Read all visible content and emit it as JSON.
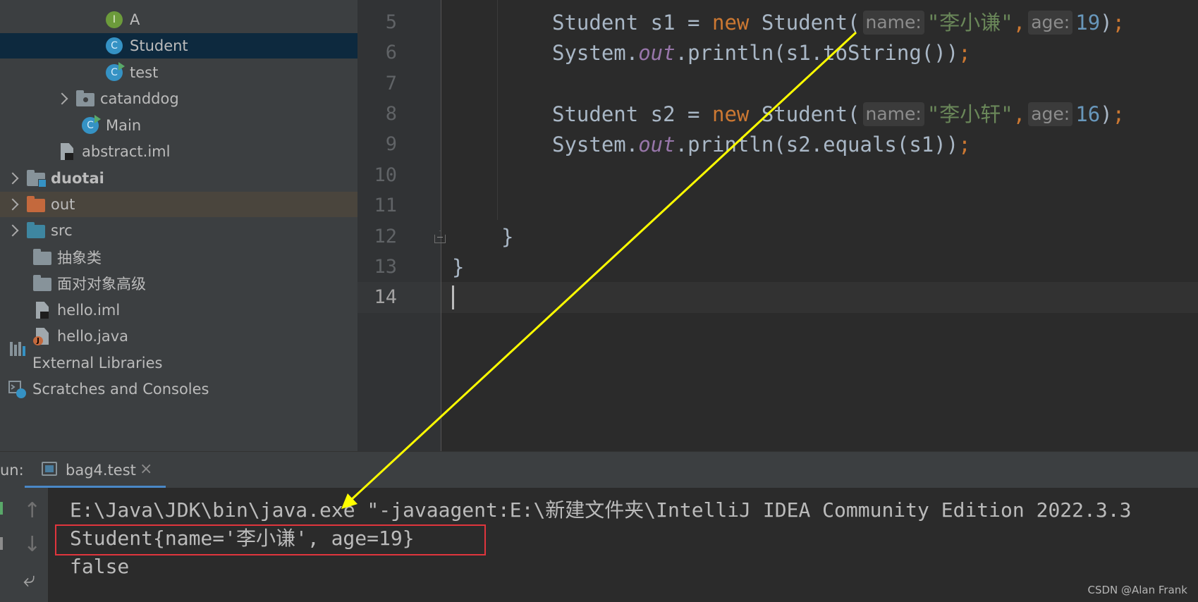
{
  "project_tree": {
    "items": [
      {
        "label": "A",
        "icon": "interface-icon",
        "badge": "I"
      },
      {
        "label": "Student",
        "icon": "class-icon",
        "badge": "C",
        "selected": true
      },
      {
        "label": "test",
        "icon": "runnable-class-icon",
        "badge": "C"
      },
      {
        "label": "catanddog",
        "icon": "package-icon"
      },
      {
        "label": "Main",
        "icon": "runnable-class-icon",
        "badge": "C"
      },
      {
        "label": "abstract.iml",
        "icon": "module-file-icon"
      },
      {
        "label": "duotai",
        "icon": "module-folder-icon"
      },
      {
        "label": "out",
        "icon": "excluded-folder-icon"
      },
      {
        "label": "src",
        "icon": "source-folder-icon"
      },
      {
        "label": "抽象类",
        "icon": "folder-icon"
      },
      {
        "label": "面对对象高级",
        "icon": "folder-icon"
      },
      {
        "label": "hello.iml",
        "icon": "module-file-icon"
      },
      {
        "label": "hello.java",
        "icon": "java-file-icon"
      },
      {
        "label": "External Libraries",
        "icon": "libraries-icon"
      },
      {
        "label": "Scratches and Consoles",
        "icon": "scratches-icon"
      }
    ]
  },
  "editor": {
    "line_numbers": [
      "5",
      "6",
      "7",
      "8",
      "9",
      "10",
      "11",
      "12",
      "13",
      "14"
    ],
    "code": {
      "l5": {
        "p1": "Student s1 = ",
        "kw": "new",
        "p2": " Student(",
        "hint_name": "name:",
        "str": "\"李小谦\"",
        "comma": ",",
        "hint_age": "age:",
        "num": "19",
        "p3": ")",
        "semi": ";"
      },
      "l6": {
        "p1": "System.",
        "field": "out",
        "p2": ".println(s1.toString())",
        "semi": ";"
      },
      "l8": {
        "p1": "Student s2 = ",
        "kw": "new",
        "p2": " Student(",
        "hint_name": "name:",
        "str": "\"李小轩\"",
        "comma": ",",
        "hint_age": "age:",
        "num": "16",
        "p3": ")",
        "semi": ";"
      },
      "l9": {
        "p1": "System.",
        "field": "out",
        "p2": ".println(s2.equals(s1))",
        "semi": ";"
      },
      "l12": "}",
      "l13": "}"
    }
  },
  "run_panel": {
    "label": "un:",
    "tab_label": "bag4.test",
    "close_glyph": "×",
    "console_lines": [
      "E:\\Java\\JDK\\bin\\java.exe \"-javaagent:E:\\新建文件夹\\IntelliJ IDEA Community Edition 2022.3.3",
      "Student{name='李小谦', age=19}",
      "false"
    ],
    "side_icons": [
      "↑",
      "↓",
      "⤶"
    ]
  },
  "colors": {
    "annotation_arrow": "#ffff00",
    "highlight_box": "#e0353d"
  },
  "watermark": "CSDN @Alan Frank"
}
